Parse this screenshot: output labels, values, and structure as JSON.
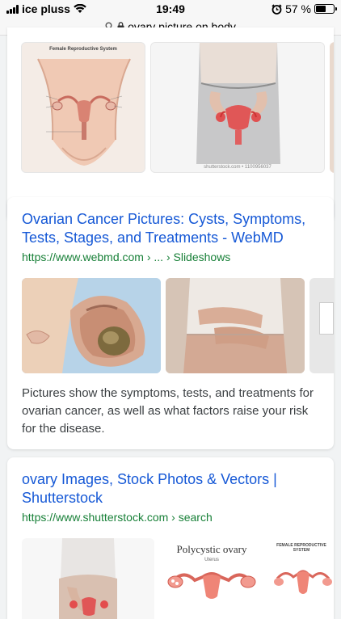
{
  "status_bar": {
    "carrier": "ice pluss",
    "time": "19:49",
    "battery_percent": "57 %",
    "battery_level": 0.57
  },
  "address_bar": {
    "query": "ovary picture on body"
  },
  "card1": {
    "images": [
      {
        "name": "female-reproductive-system-diagram",
        "caption": "Female Reproductive System"
      },
      {
        "name": "woman-holding-abdomen-ovary-overlay",
        "watermark": "shutterstock.com • 1100956037"
      }
    ]
  },
  "card2": {
    "title": "Ovarian Cancer Pictures: Cysts, Symptoms, Tests, Stages, and Treatments - WebMD",
    "url": "https://www.webmd.com › ... › Slideshows",
    "snippet": "Pictures show the symptoms, tests, and treatments for ovarian cancer, as well as what factors raise your risk for the disease."
  },
  "card3": {
    "title": "ovary Images, Stock Photos & Vectors | Shutterstock",
    "url": "https://www.shutterstock.com › search",
    "images": [
      {
        "name": "woman-hands-on-belly"
      },
      {
        "name": "polycystic-ovary-illustration",
        "caption": "Polycystic ovary",
        "sub": "Uterus"
      },
      {
        "name": "female-reproductive-system-illustration",
        "caption": "FEMALE REPRODUCTIVE SYSTEM"
      }
    ]
  },
  "colors": {
    "link": "#1558d6",
    "url_green": "#188038",
    "page_bg": "#f1f3f4"
  }
}
